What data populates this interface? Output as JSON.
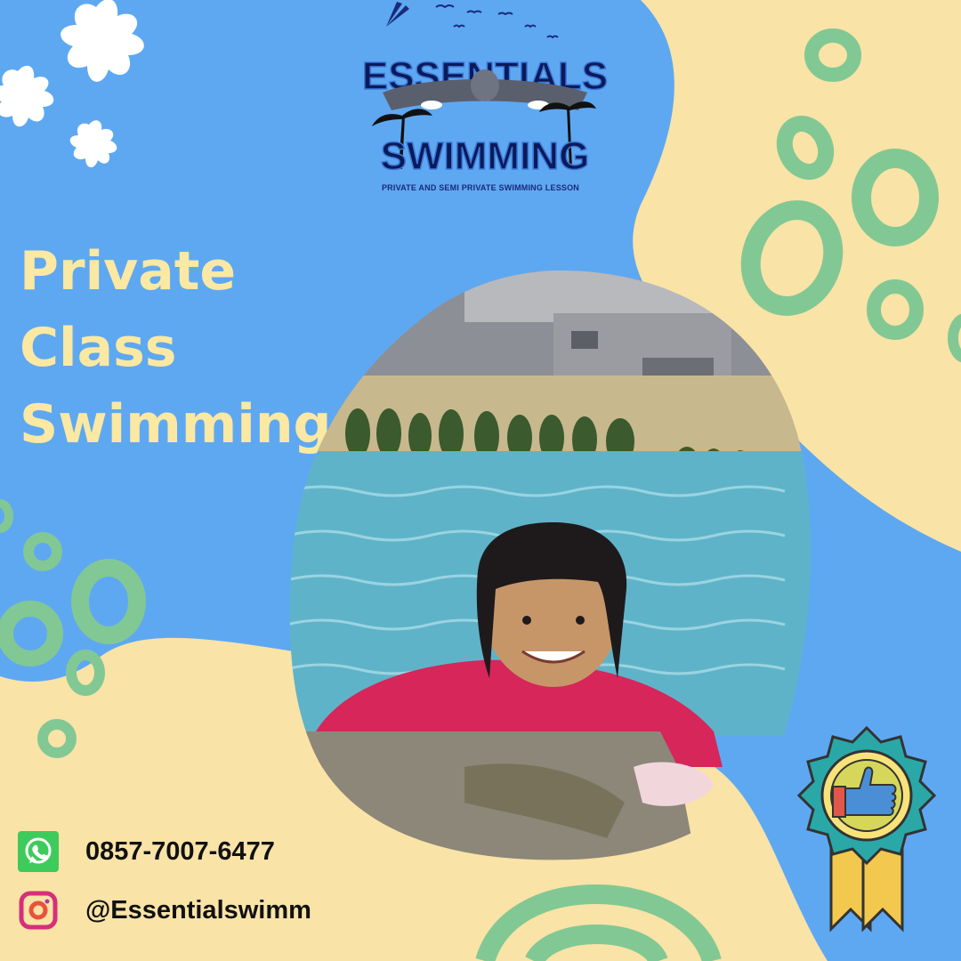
{
  "logo": {
    "word_top": "ESSENTIALS",
    "word_bottom": "SWIMMING",
    "tagline": "PRIVATE AND SEMI PRIVATE SWIMMING LESSON"
  },
  "headline": {
    "lines": [
      "Private",
      "Class",
      "Swimming"
    ]
  },
  "contacts": {
    "phone": "0857-7007-6477",
    "instagram": "@Essentialswimm"
  },
  "colors": {
    "background_yellow": "#f9e3a6",
    "blob_blue": "#5ea8f2",
    "dot_green": "#82c894",
    "headline_yellow": "#fbe8a2",
    "logo_navy": "#1a2a7a"
  },
  "icons": [
    "whatsapp-icon",
    "instagram-icon",
    "thumbs-up-badge-icon",
    "flower-icon"
  ]
}
